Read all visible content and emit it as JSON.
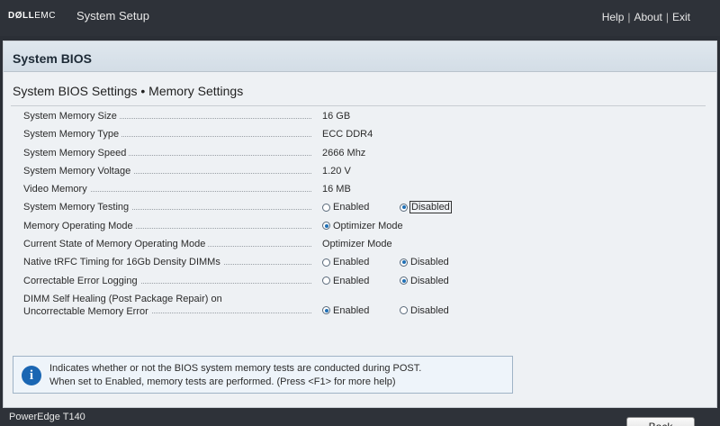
{
  "topbar": {
    "logo_dell": "DØLL",
    "logo_emc": "EMC",
    "app_title": "System Setup",
    "links": {
      "help": "Help",
      "about": "About",
      "exit": "Exit",
      "separator": "|"
    }
  },
  "panel": {
    "title": "System BIOS"
  },
  "page": {
    "title": "System BIOS Settings • Memory Settings"
  },
  "settings": [
    {
      "label": "System Memory Size",
      "value": "16 GB"
    },
    {
      "label": "System Memory Type",
      "value": "ECC DDR4"
    },
    {
      "label": "System Memory Speed",
      "value": "2666 Mhz"
    },
    {
      "label": "System Memory Voltage",
      "value": "1.20 V"
    },
    {
      "label": "Video Memory",
      "value": "16 MB"
    },
    {
      "label": "System Memory Testing",
      "options": [
        "Enabled",
        "Disabled"
      ],
      "selected": "Disabled"
    },
    {
      "label": "Memory Operating Mode",
      "options": [
        "Optimizer Mode"
      ],
      "selected": "Optimizer Mode"
    },
    {
      "label": "Current State of Memory Operating Mode",
      "value": "Optimizer Mode"
    },
    {
      "label": "Native tRFC Timing for 16Gb Density DIMMs",
      "options": [
        "Enabled",
        "Disabled"
      ],
      "selected": "Disabled"
    },
    {
      "label": "Correctable Error Logging",
      "options": [
        "Enabled",
        "Disabled"
      ],
      "selected": "Disabled"
    },
    {
      "label_line1": "DIMM Self Healing (Post Package Repair) on",
      "label_line2": "Uncorrectable Memory Error",
      "options": [
        "Enabled",
        "Disabled"
      ],
      "selected": "Enabled"
    }
  ],
  "help": {
    "icon": "info-icon",
    "line1": "Indicates whether or not the BIOS system memory tests are conducted during POST.",
    "line2": "When set to Enabled, memory tests are performed. (Press <F1> for more help)"
  },
  "footer": {
    "model": "PowerEdge T140",
    "back_label": "Back"
  },
  "colors": {
    "topbar": "#2e3239",
    "panel_bg": "#eef1f4",
    "accent": "#1f6fb5",
    "info_icon": "#1a66b3"
  }
}
